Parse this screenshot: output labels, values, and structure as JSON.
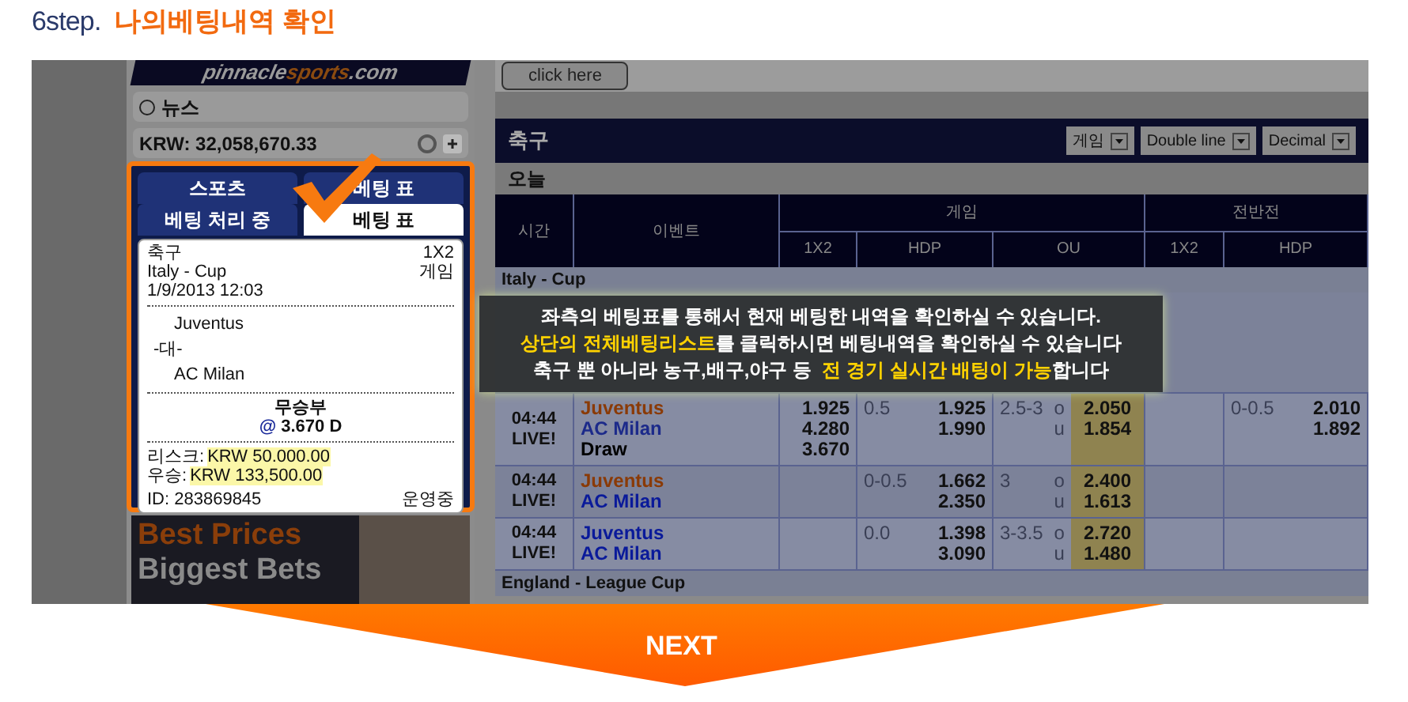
{
  "heading": {
    "step": "6step.",
    "title": "나의베팅내역 확인"
  },
  "site": {
    "logo_1": "pinnacle",
    "logo_2": "sports",
    "logo_3": ".com",
    "promo_button": "click here"
  },
  "sidebar": {
    "news": "뉴스",
    "balance": "KRW: 32,058,670.33",
    "tabs": [
      {
        "label": "스포츠",
        "selected": false
      },
      {
        "label": "베팅 표",
        "selected": false
      },
      {
        "label": "베팅 처리 중",
        "selected": false
      },
      {
        "label": "베팅 표",
        "selected": true
      }
    ],
    "bet_slip": {
      "sport": "축구",
      "market": "1X2",
      "league": "Italy - Cup",
      "period": "게임",
      "date": "1/9/2013 12:03",
      "home": "Juventus",
      "versus": "-대-",
      "away": "AC Milan",
      "pick": "무승부",
      "at": "@",
      "price": "3.670 D",
      "risk_label": "리스크:",
      "risk": "KRW 50.000.00",
      "win_label": "우승:",
      "win": "KRW 133,500.00",
      "id": "ID: 283869845",
      "status": "운영중"
    },
    "banner": {
      "line_1": "Best Prices",
      "line_2": "Biggest Bets"
    }
  },
  "main": {
    "title": "축구",
    "selects": [
      "게임",
      "Double line",
      "Decimal"
    ],
    "day": "오늘",
    "columns": {
      "time": "시간",
      "event": "이벤트",
      "groups": [
        {
          "label": "게임",
          "columns": [
            "1X2",
            "HDP",
            "OU"
          ]
        },
        {
          "label": "전반전",
          "columns": [
            "1X2",
            "HDP"
          ]
        }
      ]
    },
    "sections": [
      {
        "league": "Italy - Cup",
        "rows": [
          {
            "time": "04:44",
            "live": "LIVE!",
            "teams": [
              {
                "name": "Juventus",
                "color": "#8a3a06"
              },
              {
                "name": "AC Milan",
                "color": "#1c2a8a"
              },
              {
                "name": "Draw",
                "color": "#000000"
              }
            ],
            "x12": [
              "1.925",
              "4.280",
              "3.670"
            ],
            "hdp": {
              "line": "0.5",
              "odds": [
                "1.925",
                "1.990"
              ]
            },
            "ou": {
              "line": "2.5-3",
              "sides": [
                "o",
                "u"
              ],
              "odds": [
                "2.050",
                "1.854"
              ]
            },
            "h1_hdp": {
              "line": "0-0.5",
              "odds": [
                "2.010",
                "1.892"
              ]
            }
          },
          {
            "time": "04:44",
            "live": "LIVE!",
            "teams": [
              {
                "name": "Juventus",
                "color": "#8a3a06"
              },
              {
                "name": "AC Milan",
                "color": "#0a1a9a"
              }
            ],
            "hdp": {
              "line": "0-0.5",
              "odds": [
                "1.662",
                "2.350"
              ]
            },
            "ou": {
              "line": "3",
              "sides": [
                "o",
                "u"
              ],
              "odds": [
                "2.400",
                "1.613"
              ]
            }
          },
          {
            "time": "04:44",
            "live": "LIVE!",
            "teams": [
              {
                "name": "Juventus",
                "color": "#0a1a9a"
              },
              {
                "name": "AC Milan",
                "color": "#0a1a9a"
              }
            ],
            "hdp": {
              "line": "0.0",
              "odds": [
                "1.398",
                "3.090"
              ]
            },
            "ou": {
              "line": "3-3.5",
              "sides": [
                "o",
                "u"
              ],
              "odds": [
                "2.720",
                "1.480"
              ]
            }
          }
        ]
      },
      {
        "league": "England - League Cup"
      }
    ]
  },
  "callout": {
    "lines": [
      [
        {
          "text": "좌측의 베팅표를 통해서 현재 베팅한 내역을 확인하실 수 있습니다.",
          "highlight": false
        }
      ],
      [
        {
          "text": "상단의 전체베팅리스트",
          "highlight": true
        },
        {
          "text": "를 클릭하시면 베팅내역을 확인하실 수 있습니다",
          "highlight": false
        }
      ],
      [
        {
          "text": "축구 뿐 아니라 농구,배구,야구 등  ",
          "highlight": false
        },
        {
          "text": "전 경기 실시간 배팅이 가능",
          "highlight": true
        },
        {
          "text": "합니다",
          "highlight": false
        }
      ]
    ]
  },
  "next": "NEXT"
}
